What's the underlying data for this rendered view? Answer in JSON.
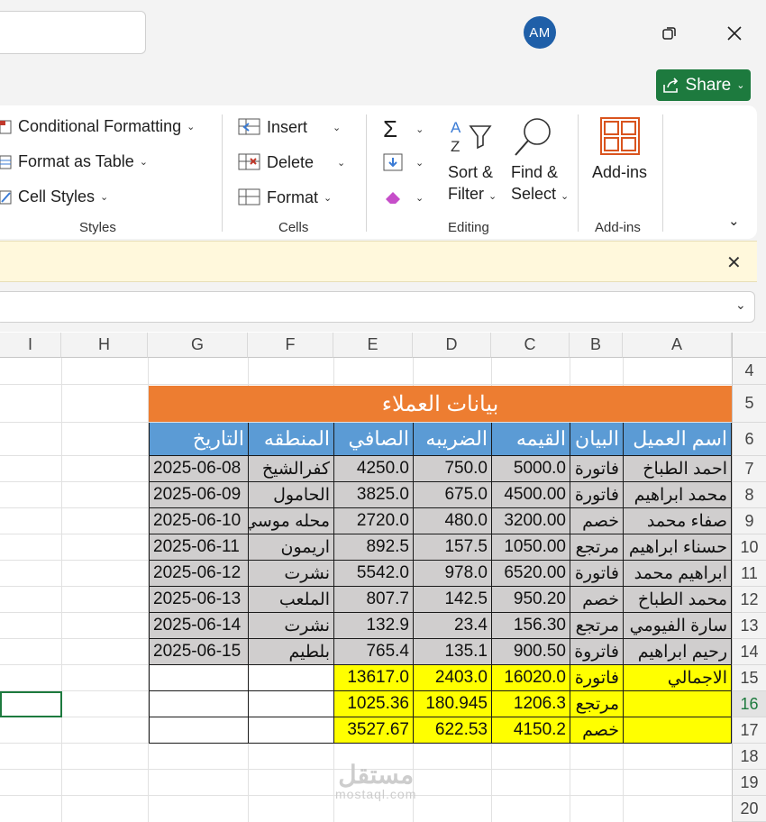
{
  "titlebar": {
    "avatar_initials": "AM",
    "share_label": "Share"
  },
  "ribbon": {
    "styles": {
      "conditional_formatting": "Conditional Formatting",
      "format_as_table": "Format as Table",
      "cell_styles": "Cell Styles",
      "group_label": "Styles"
    },
    "cells": {
      "insert": "Insert",
      "delete": "Delete",
      "format": "Format",
      "group_label": "Cells"
    },
    "editing": {
      "sort_filter_line1": "Sort &",
      "sort_filter_line2": "Filter",
      "find_select_line1": "Find &",
      "find_select_line2": "Select",
      "group_label": "Editing"
    },
    "addins": {
      "button_label": "Add-ins",
      "group_label": "Add-ins"
    }
  },
  "columns": [
    "I",
    "H",
    "G",
    "F",
    "E",
    "D",
    "C",
    "B",
    "A"
  ],
  "rows": [
    "4",
    "5",
    "6",
    "7",
    "8",
    "9",
    "10",
    "11",
    "12",
    "13",
    "14",
    "15",
    "16",
    "17",
    "18",
    "19",
    "20"
  ],
  "sheet": {
    "title": "بيانات العملاء",
    "headers": {
      "A": "اسم العميل",
      "B": "البيان",
      "C": "القيمه",
      "D": "الضريبه",
      "E": "الصافي",
      "F": "المنطقه",
      "G": "التاريخ"
    },
    "data_rows": [
      {
        "A": "احمد الطباخ",
        "B": "فاتورة",
        "C": "5000.0",
        "D": "750.0",
        "E": "4250.0",
        "F": "كفرالشيخ",
        "G": "2025-06-08"
      },
      {
        "A": "محمد ابراهيم",
        "B": "فاتورة",
        "C": "4500.00",
        "D": "675.0",
        "E": "3825.0",
        "F": "الحامول",
        "G": "2025-06-09"
      },
      {
        "A": "صفاء محمد",
        "B": "خصم",
        "C": "3200.00",
        "D": "480.0",
        "E": "2720.0",
        "F": "محله موسي",
        "G": "2025-06-10"
      },
      {
        "A": "حسناء ابراهيم",
        "B": "مرتجع",
        "C": "1050.00",
        "D": "157.5",
        "E": "892.5",
        "F": "اريمون",
        "G": "2025-06-11"
      },
      {
        "A": "ابراهيم محمد",
        "B": "فاتورة",
        "C": "6520.00",
        "D": "978.0",
        "E": "5542.0",
        "F": "نشرت",
        "G": "2025-06-12"
      },
      {
        "A": "محمد الطباخ",
        "B": "خصم",
        "C": "950.20",
        "D": "142.5",
        "E": "807.7",
        "F": "الملعب",
        "G": "2025-06-13"
      },
      {
        "A": "سارة الفيومي",
        "B": "مرتجع",
        "C": "156.30",
        "D": "23.4",
        "E": "132.9",
        "F": "نشرت",
        "G": "2025-06-14"
      },
      {
        "A": "رحيم ابراهيم",
        "B": "فاتروة",
        "C": "900.50",
        "D": "135.1",
        "E": "765.4",
        "F": "بلطيم",
        "G": "2025-06-15"
      }
    ],
    "totals_label": "الاجمالي",
    "totals": [
      {
        "B": "فاتورة",
        "C": "16020.0",
        "D": "2403.0",
        "E": "13617.0"
      },
      {
        "B": "مرتجع",
        "C": "1206.3",
        "D": "180.945",
        "E": "1025.36"
      },
      {
        "B": "خصم",
        "C": "4150.2",
        "D": "622.53",
        "E": "3527.67"
      }
    ]
  },
  "watermark": {
    "arabic": "مستقل",
    "latin": "mostaql.com"
  },
  "colors": {
    "header_blue": "#5b9bd5",
    "title_orange": "#ed7d31",
    "data_gray": "#d0cece",
    "totals_yellow": "#ffff00",
    "share_green": "#1d7a3e",
    "avatar_blue": "#1f5fa8"
  }
}
